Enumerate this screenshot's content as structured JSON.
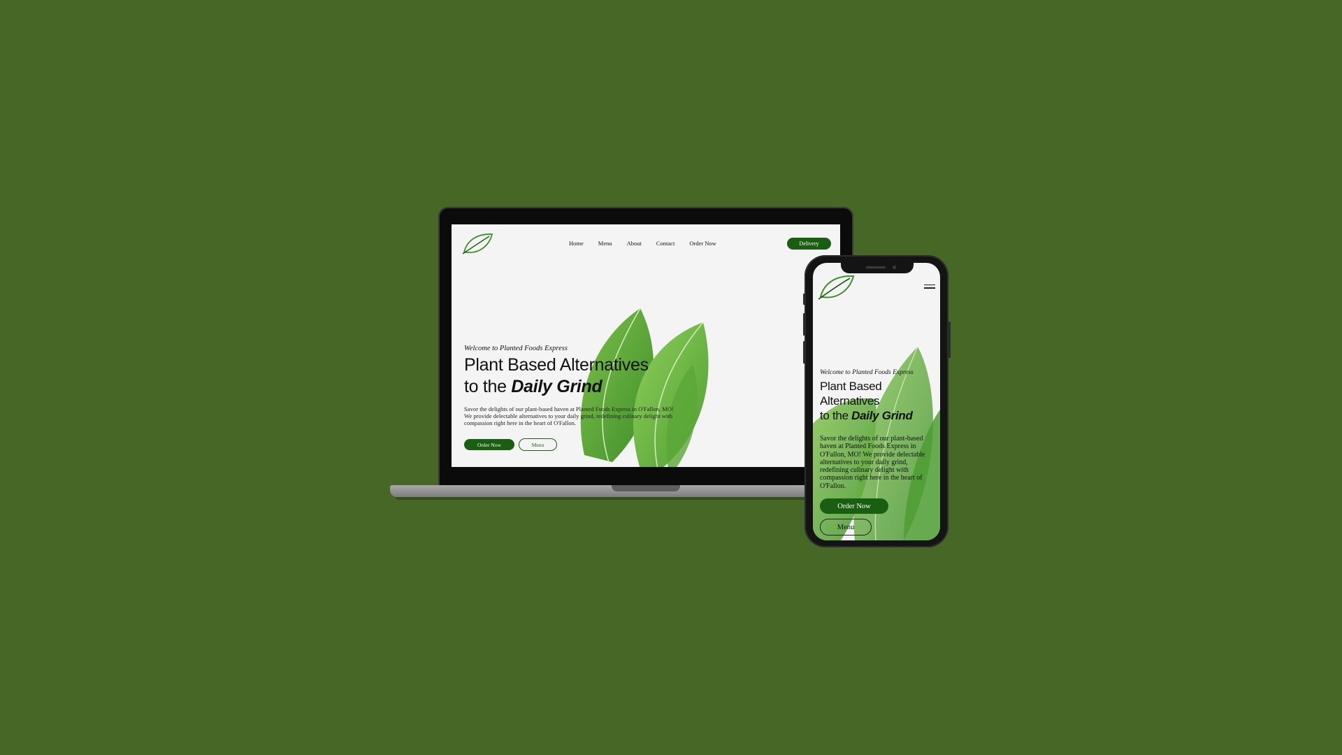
{
  "colors": {
    "background": "#466726",
    "brand_green": "#1a5e12",
    "screen_bg": "#f4f4f4"
  },
  "laptop": {
    "nav": {
      "items": [
        "Home",
        "Menu",
        "About",
        "Contact",
        "Order Now"
      ],
      "delivery_label": "Delivery"
    },
    "hero": {
      "welcome": "Welcome to Planted Foods Express",
      "title_line1": "Plant Based Alternatives",
      "title_line2_prefix": "to the",
      "title_line2_emph": "Daily Grind",
      "body": "Savor the delights of our plant-based haven at Planted Foods Express in O'Fallon, MO! We provide delectable alternatives to your daily grind, redefining culinary delight with compassion right here in the heart of O'Fallon.",
      "order_label": "Order Now",
      "menu_label": "Menu"
    }
  },
  "phone": {
    "hero": {
      "welcome": "Welcome to Planted Foods Express",
      "title_line1": "Plant Based",
      "title_line2": "Alternatives",
      "title_line3_prefix": "to the",
      "title_line3_emph": "Daily Grind",
      "body": "Savor the delights of our plant-based haven at Planted Foods Express in O'Fallon, MO! We provide delectable alternatives to your daily grind, redefining culinary delight with compassion right here in the heart of O'Fallon.",
      "order_label": "Order Now",
      "menu_label": "Menu"
    }
  },
  "icons": {
    "logo": "leaf-logo-icon",
    "hamburger": "hamburger-menu-icon"
  }
}
